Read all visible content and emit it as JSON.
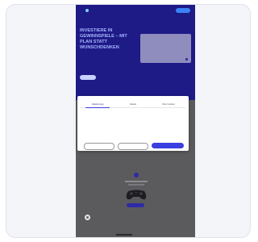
{
  "nav": {
    "logo": "",
    "links": [
      "",
      "",
      ""
    ],
    "cta": ""
  },
  "hero": {
    "headline": "INVESTIERE IN GEWINNSPIELE – MIT PLAN STATT WUNSCHDENKEN",
    "subtext": "",
    "button": "",
    "media_badge": "",
    "stats": [
      "",
      "",
      ""
    ]
  },
  "cookie_modal": {
    "brand": "",
    "tabs": [
      "Zustimmung",
      "Details",
      "Über Cookies"
    ],
    "title": "",
    "body_lines": [
      "",
      "",
      "",
      "",
      "",
      "",
      "",
      "",
      "",
      ""
    ],
    "buttons": {
      "choose": "",
      "reject": "",
      "accept": ""
    }
  },
  "colors": {
    "brand_dark": "#1e1a86",
    "accent": "#3b3fe0",
    "overlay": "#5b5b5e"
  },
  "icons": [
    "chat-bubble-icon",
    "controller-icon",
    "logo-mark-icon"
  ]
}
